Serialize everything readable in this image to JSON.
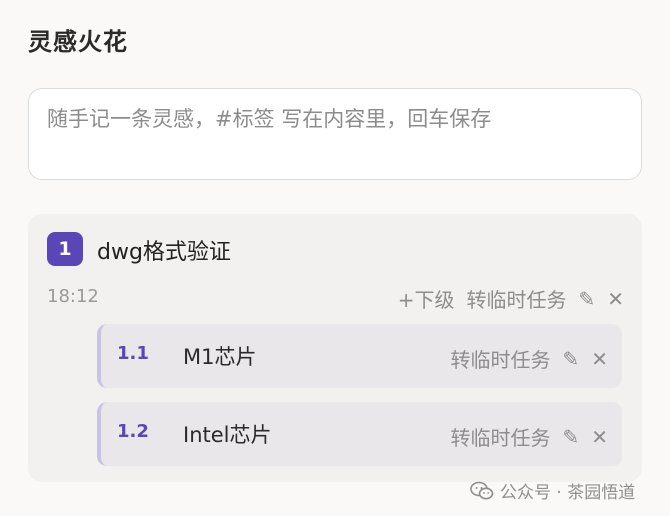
{
  "page": {
    "title": "灵感火花"
  },
  "input": {
    "placeholder": "随手记一条灵感，#标签 写在内容里，回车保存"
  },
  "card": {
    "number": "1",
    "title": "dwg格式验证",
    "time": "18:12",
    "actions": {
      "add_sub": "+下级",
      "to_task": "转临时任务",
      "edit_icon": "✎",
      "close_icon": "✕"
    },
    "subitems": [
      {
        "number": "1.1",
        "title": "M1芯片",
        "to_task": "转临时任务",
        "edit_icon": "✎",
        "close_icon": "✕"
      },
      {
        "number": "1.2",
        "title": "Intel芯片",
        "to_task": "转临时任务",
        "edit_icon": "✎",
        "close_icon": "✕"
      }
    ]
  },
  "watermark": {
    "text": "公众号 · 茶园悟道",
    "icon": "wechat-icon"
  },
  "colors": {
    "accent": "#5b46b8",
    "background": "#faf9f7",
    "card": "#f2f1ef",
    "subcard": "#e9e7ea"
  }
}
